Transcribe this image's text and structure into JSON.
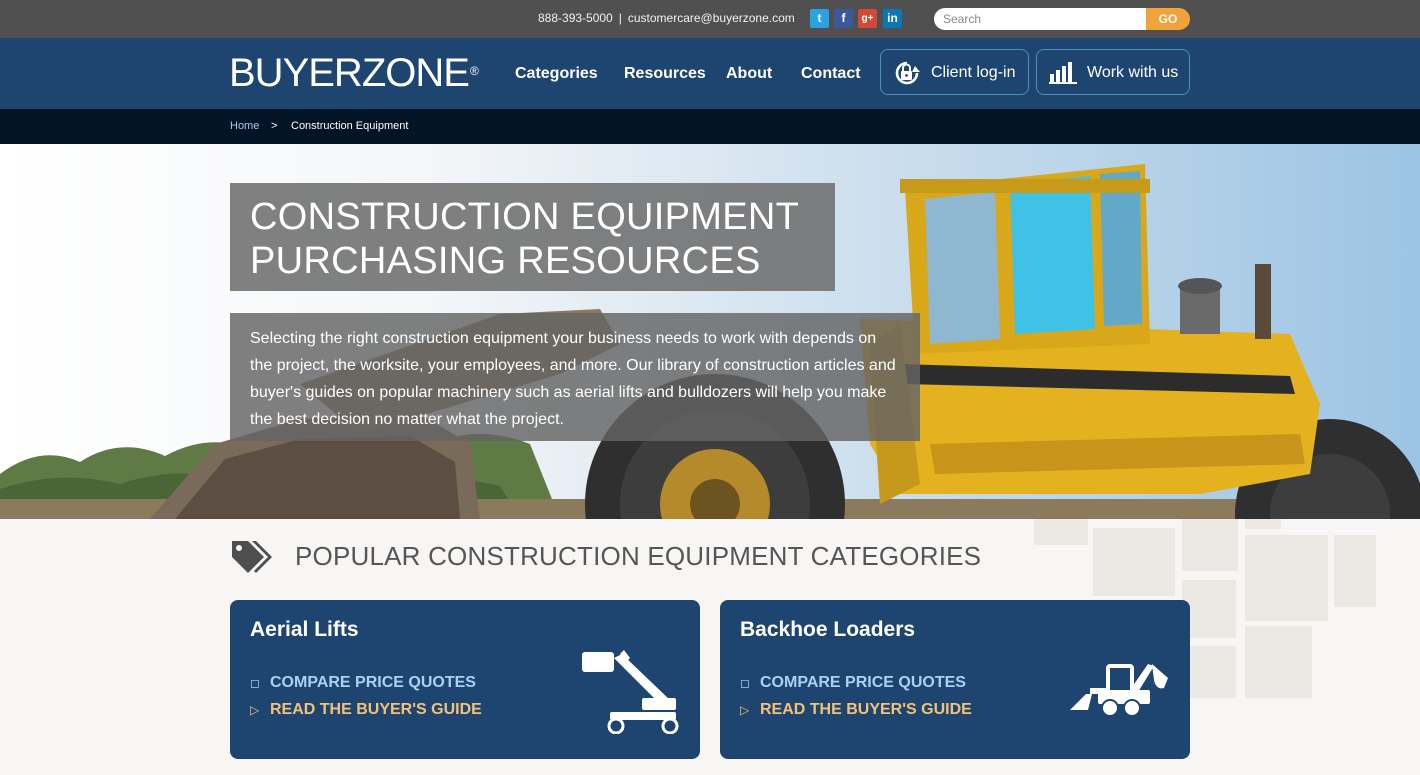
{
  "topbar": {
    "phone": "888-393-5000",
    "separator": "|",
    "email": "customercare@buyerzone.com",
    "social": [
      {
        "name": "twitter-icon",
        "glyph": "t"
      },
      {
        "name": "facebook-icon",
        "glyph": "f"
      },
      {
        "name": "google-plus-icon",
        "glyph": "g+"
      },
      {
        "name": "linkedin-icon",
        "glyph": "in"
      }
    ],
    "search": {
      "placeholder": "Search",
      "value": ""
    },
    "go_label": "GO"
  },
  "header": {
    "logo_text": "BUYERZONE",
    "logo_mark": "®",
    "nav": [
      "Categories",
      "Resources",
      "About",
      "Contact"
    ],
    "login_label": "Client log-in",
    "work_label": "Work with us"
  },
  "breadcrumb": {
    "home": "Home",
    "separator": ">",
    "current": "Construction Equipment"
  },
  "hero": {
    "title_line1": "CONSTRUCTION EQUIPMENT",
    "title_line2": "PURCHASING RESOURCES",
    "description": "Selecting the right construction equipment your business needs to work with depends on the project, the worksite, your employees, and more. Our library of construction articles and buyer's guides on popular machinery such as aerial lifts and bulldozers will help you make the best decision no matter what the project."
  },
  "categories": {
    "title": "POPULAR CONSTRUCTION EQUIPMENT CATEGORIES",
    "cards": [
      {
        "title": "Aerial Lifts",
        "quotes_label": "COMPARE PRICE QUOTES",
        "guide_label": "READ THE BUYER'S GUIDE",
        "icon": "aerial-lift-icon"
      },
      {
        "title": "Backhoe Loaders",
        "quotes_label": "COMPARE PRICE QUOTES",
        "guide_label": "READ THE BUYER'S GUIDE",
        "icon": "backhoe-loader-icon"
      }
    ]
  },
  "colors": {
    "topbar": "#505050",
    "header": "#1e4570",
    "breadcrumb_bar": "#021426",
    "accent_orange": "#f0a33a",
    "link_blue": "#a9d3f2",
    "link_gold": "#f2c27a"
  }
}
